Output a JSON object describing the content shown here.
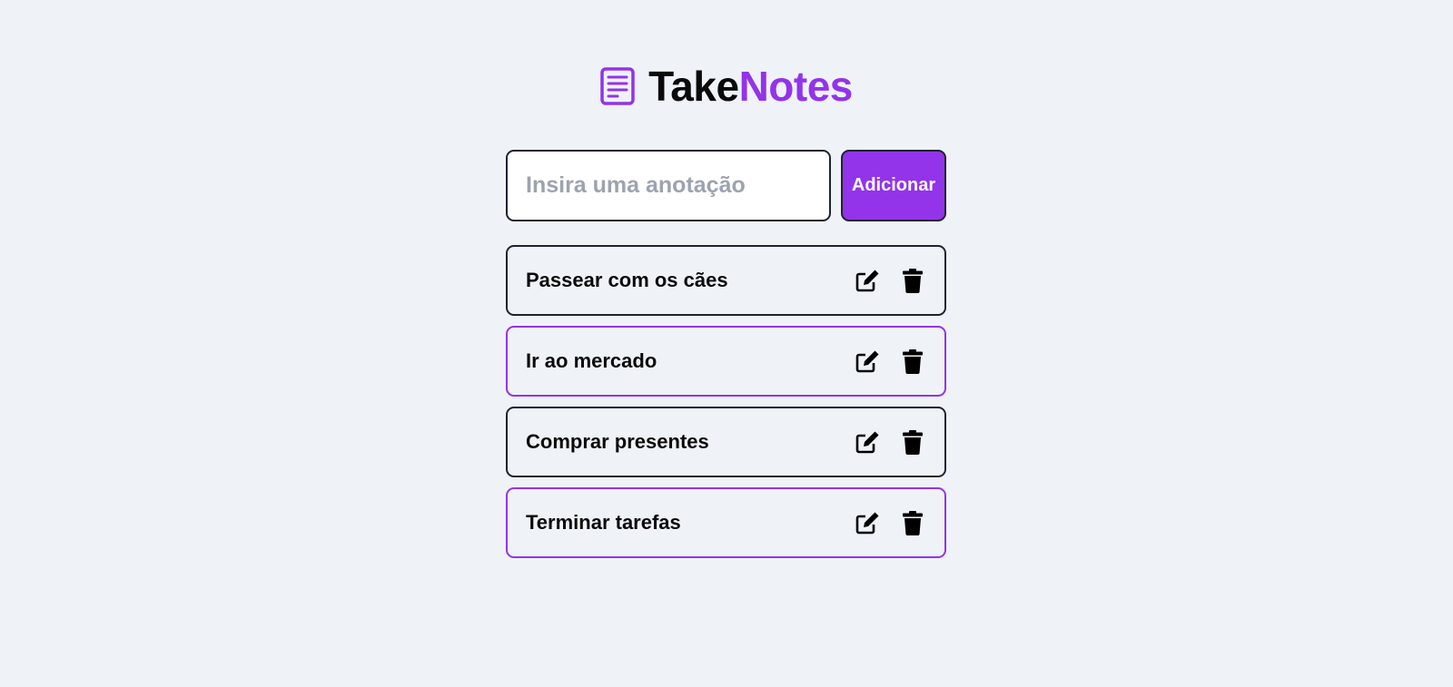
{
  "header": {
    "title_part1": "Take",
    "title_part2": "Notes",
    "logo_icon": "note-icon",
    "accent_color": "#9333ea"
  },
  "form": {
    "input_value": "",
    "input_placeholder": "Insira uma anotação",
    "add_label": "Adicionar"
  },
  "notes": [
    {
      "text": "Passear com os cães",
      "border": "dark"
    },
    {
      "text": "Ir ao mercado",
      "border": "purple"
    },
    {
      "text": "Comprar presentes",
      "border": "dark"
    },
    {
      "text": "Terminar tarefas",
      "border": "purple"
    }
  ],
  "icons": {
    "edit": "edit-icon",
    "delete": "trash-icon"
  }
}
